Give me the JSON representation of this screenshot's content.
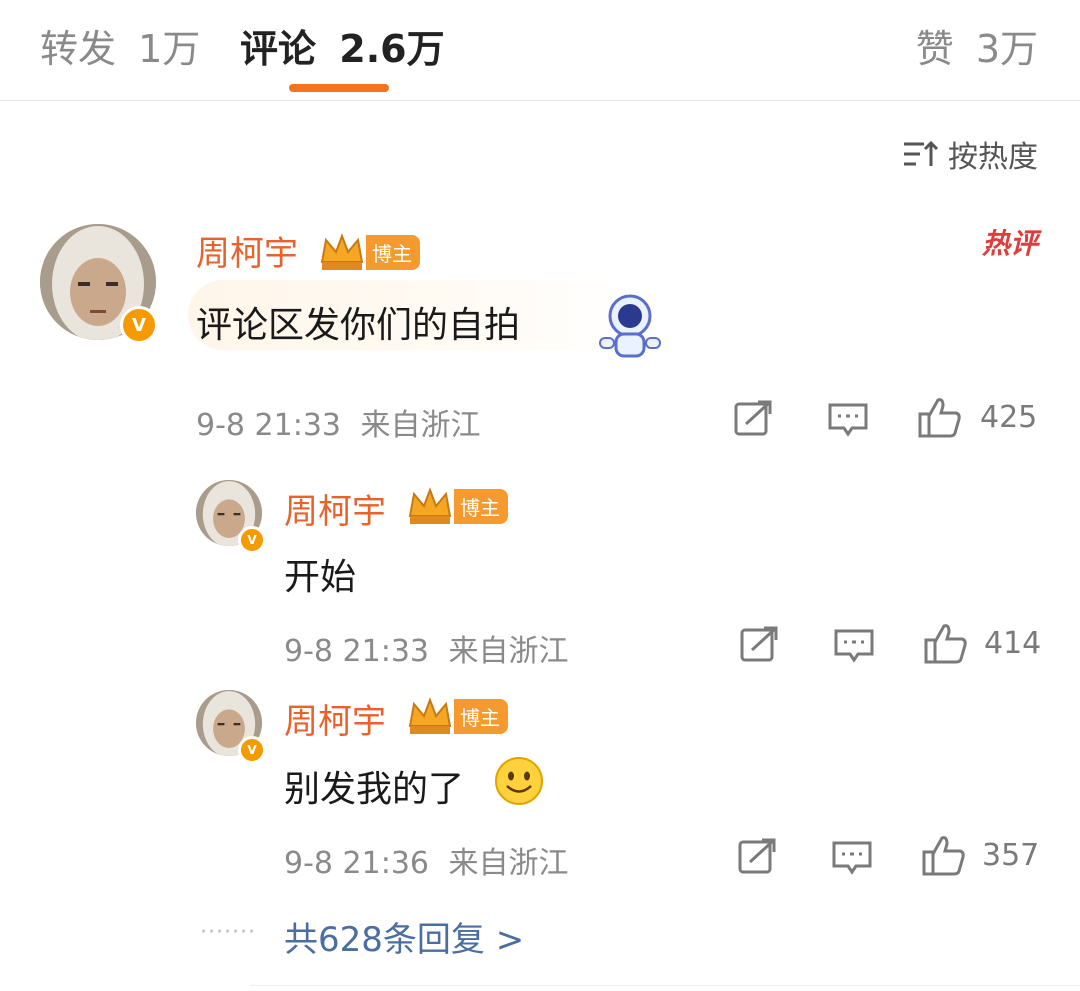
{
  "tabs": [
    {
      "label": "转发",
      "count": "1万"
    },
    {
      "label": "评论",
      "count": "2.6万"
    },
    {
      "label": "赞",
      "count": "3万"
    }
  ],
  "sort": {
    "label": "按热度",
    "icon": "sort-icon"
  },
  "main_comment": {
    "username": "周柯宇",
    "badge": "博主",
    "hot_label": "热评",
    "text": "评论区发你们的自拍",
    "time": "9-8 21:33",
    "location": "来自浙江",
    "likes": "425"
  },
  "replies": [
    {
      "username": "周柯宇",
      "badge": "博主",
      "text": "开始",
      "time": "9-8 21:33",
      "location": "来自浙江",
      "likes": "414"
    },
    {
      "username": "周柯宇",
      "badge": "博主",
      "text": "别发我的了",
      "time": "9-8 21:36",
      "location": "来自浙江",
      "likes": "357"
    }
  ],
  "more_replies": "共628条回复 >",
  "colors": {
    "accent": "#f5731f",
    "username": "#e8622c",
    "link": "#4a6ea0",
    "hot": "#e23b3b"
  }
}
